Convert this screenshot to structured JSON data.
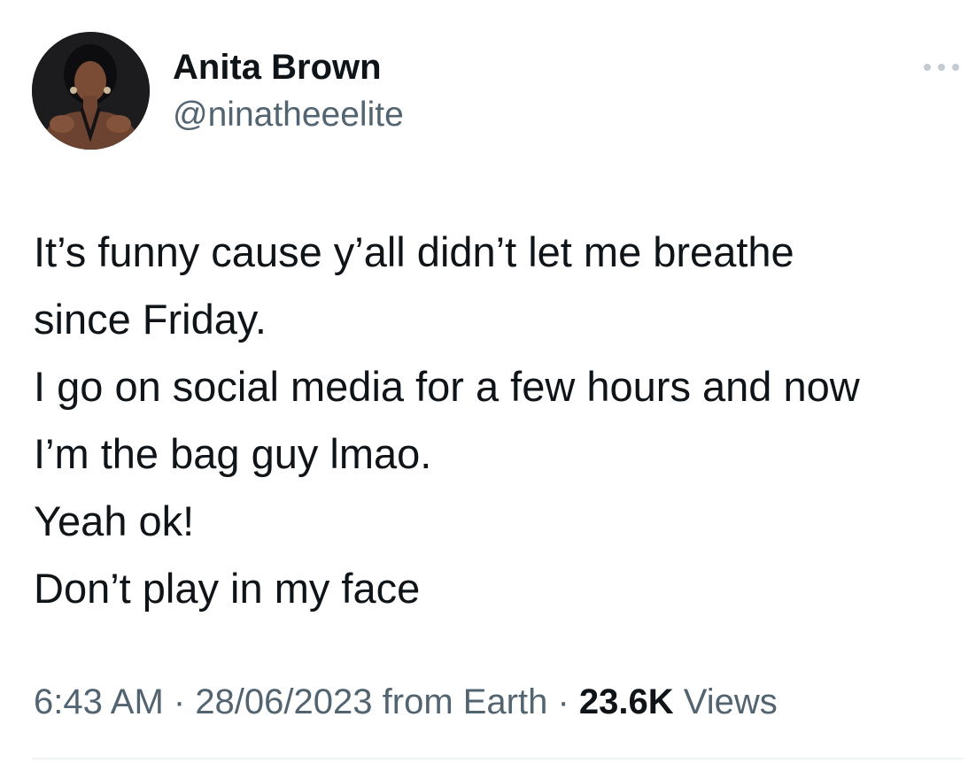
{
  "author": {
    "display_name": "Anita Brown",
    "handle": "@ninatheeelite",
    "avatar_icon": "profile-photo"
  },
  "tweet": {
    "lines": [
      "It’s funny cause y’all didn’t let me breathe",
      "since Friday.",
      "I go on social media for a few hours and now",
      "I’m the bag guy lmao.",
      "Yeah ok!",
      "Don’t play in my face"
    ]
  },
  "meta": {
    "time": "6:43 AM",
    "separator": " · ",
    "date": "28/06/2023",
    "source": "from Earth",
    "views_count": "23.6K",
    "views_label": "Views"
  },
  "menu": {
    "more_icon": "more-horizontal-icon"
  },
  "colors": {
    "text_primary": "#0f1419",
    "text_secondary": "#536471",
    "divider": "#eff3f4"
  }
}
